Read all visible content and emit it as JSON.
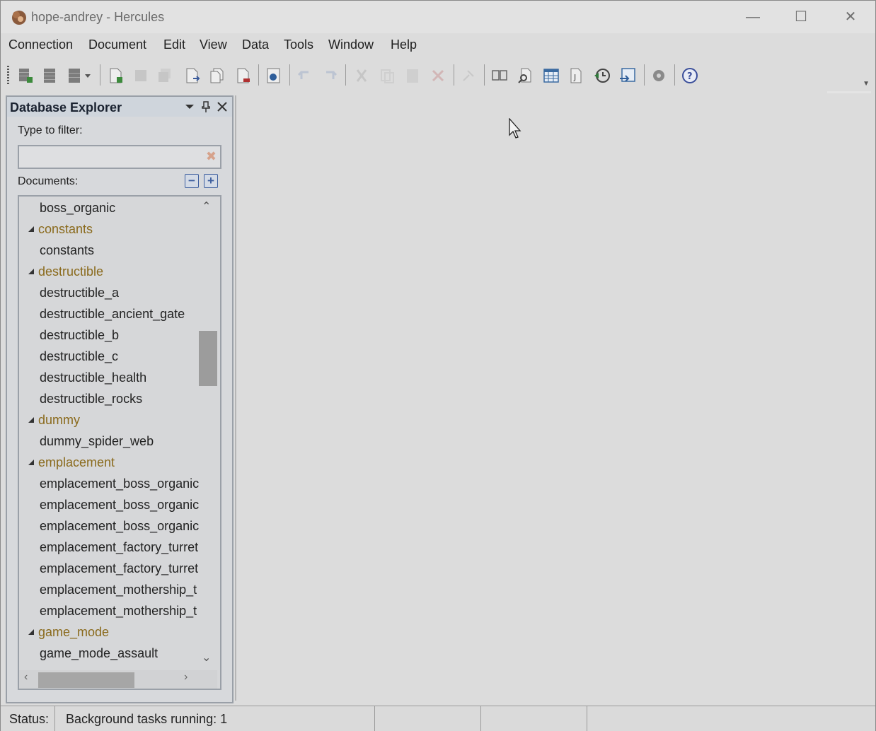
{
  "window": {
    "title": "hope-andrey - Hercules"
  },
  "menu": [
    "Connection",
    "Document",
    "Edit",
    "View",
    "Data",
    "Tools",
    "Window",
    "Help"
  ],
  "toolbar": {
    "buttons": [
      "new-connection-icon",
      "disconnect-icon",
      "database-dropdown-icon",
      "new-document-icon",
      "save-icon",
      "save-all-icon",
      "open-document-icon",
      "copy-document-icon",
      "close-document-icon",
      "database-icon",
      "undo-icon",
      "redo-icon",
      "cut-icon",
      "copy-icon",
      "paste-icon",
      "delete-icon",
      "compare-icon",
      "find-replace-icon",
      "table-view-icon",
      "script-icon",
      "history-icon",
      "export-icon",
      "settings-icon",
      "help-icon"
    ]
  },
  "explorer": {
    "title": "Database Explorer",
    "filter_label": "Type to filter:",
    "filter_value": "",
    "documents_label": "Documents:",
    "tree": [
      {
        "type": "leaf",
        "label": "boss_organic"
      },
      {
        "type": "group",
        "label": "constants"
      },
      {
        "type": "leaf",
        "label": "constants"
      },
      {
        "type": "group",
        "label": "destructible"
      },
      {
        "type": "leaf",
        "label": "destructible_a"
      },
      {
        "type": "leaf",
        "label": "destructible_ancient_gate"
      },
      {
        "type": "leaf",
        "label": "destructible_b"
      },
      {
        "type": "leaf",
        "label": "destructible_c"
      },
      {
        "type": "leaf",
        "label": "destructible_health"
      },
      {
        "type": "leaf",
        "label": "destructible_rocks"
      },
      {
        "type": "group",
        "label": "dummy"
      },
      {
        "type": "leaf",
        "label": "dummy_spider_web"
      },
      {
        "type": "group",
        "label": "emplacement"
      },
      {
        "type": "leaf",
        "label": "emplacement_boss_organic"
      },
      {
        "type": "leaf",
        "label": "emplacement_boss_organic"
      },
      {
        "type": "leaf",
        "label": "emplacement_boss_organic"
      },
      {
        "type": "leaf",
        "label": "emplacement_factory_turret"
      },
      {
        "type": "leaf",
        "label": "emplacement_factory_turret"
      },
      {
        "type": "leaf",
        "label": "emplacement_mothership_t"
      },
      {
        "type": "leaf",
        "label": "emplacement_mothership_t"
      },
      {
        "type": "group",
        "label": "game_mode"
      },
      {
        "type": "leaf",
        "label": "game_mode_assault"
      }
    ]
  },
  "status": {
    "label": "Status:",
    "text": "Background tasks running: 1"
  }
}
